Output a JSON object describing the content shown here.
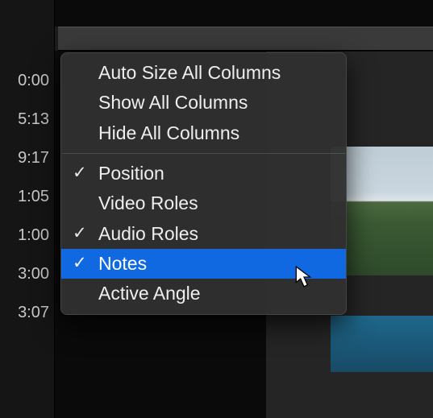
{
  "timecodes": [
    "0:00",
    "5:13",
    "9:17",
    "1:05",
    "1:00",
    "3:00",
    "3:07"
  ],
  "menu": {
    "commands": [
      "Auto Size All Columns",
      "Show All Columns",
      "Hide All Columns"
    ],
    "columns": [
      {
        "label": "Position",
        "checked": true,
        "highlight": false
      },
      {
        "label": "Video Roles",
        "checked": false,
        "highlight": false
      },
      {
        "label": "Audio Roles",
        "checked": true,
        "highlight": false
      },
      {
        "label": "Notes",
        "checked": true,
        "highlight": true
      },
      {
        "label": "Active Angle",
        "checked": false,
        "highlight": false
      }
    ]
  }
}
